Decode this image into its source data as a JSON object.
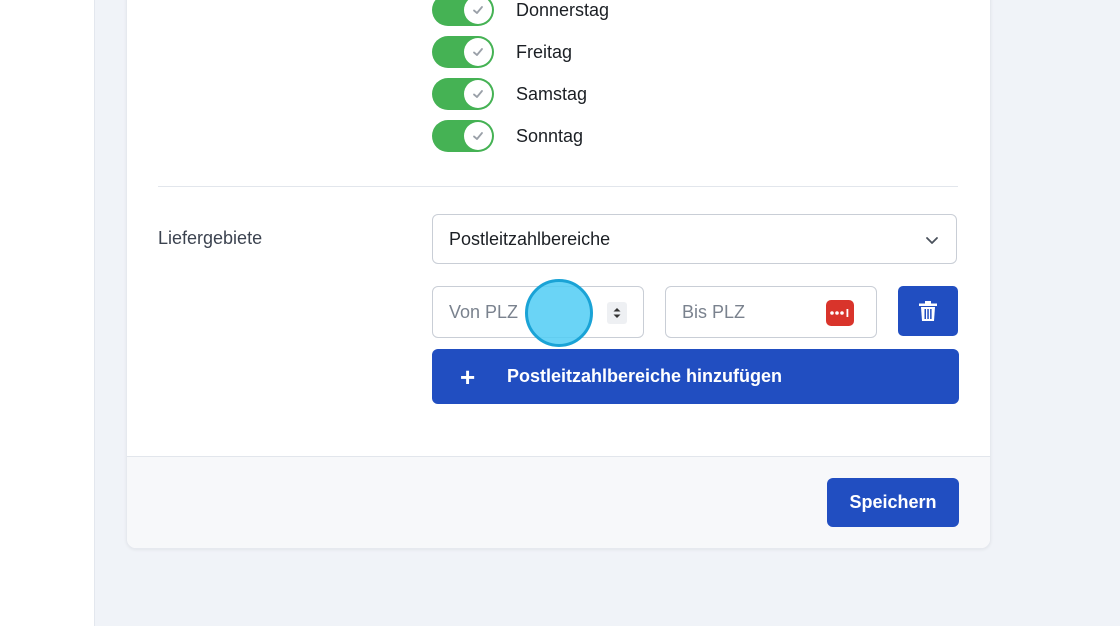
{
  "days": [
    {
      "label": "Donnerstag",
      "enabled": true
    },
    {
      "label": "Freitag",
      "enabled": true
    },
    {
      "label": "Samstag",
      "enabled": true
    },
    {
      "label": "Sonntag",
      "enabled": true
    }
  ],
  "delivery": {
    "label": "Liefergebiete",
    "select_value": "Postleitzahlbereiche",
    "from_placeholder": "Von PLZ",
    "to_placeholder": "Bis PLZ",
    "add_label": "Postleitzahlbereiche hinzufügen"
  },
  "footer": {
    "save_label": "Speichern"
  },
  "icons": {
    "toggle_check": "check-icon",
    "select_chevron": "chevron-down-icon",
    "number_spinner": "spinner-icon",
    "password_manager": "password-manager-icon",
    "delete": "trash-icon",
    "add": "plus-icon"
  },
  "colors": {
    "primary": "#214ec1",
    "toggle_on": "#45b254",
    "danger_icon": "#d9342b"
  }
}
